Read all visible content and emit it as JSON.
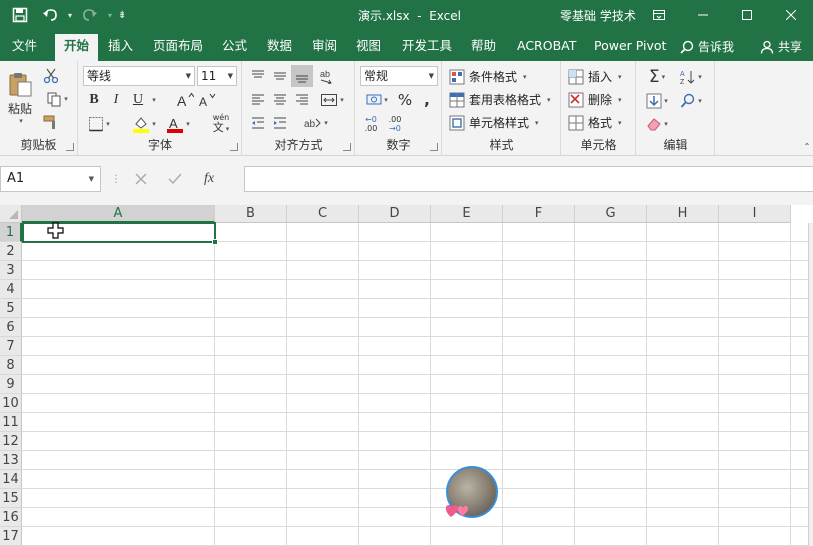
{
  "titlebar": {
    "doc_title": "演示.xlsx  -  Excel",
    "brand": "零基础 学技术"
  },
  "tabs": [
    {
      "label": "文件"
    },
    {
      "label": "开始"
    },
    {
      "label": "插入"
    },
    {
      "label": "页面布局"
    },
    {
      "label": "公式"
    },
    {
      "label": "数据"
    },
    {
      "label": "审阅"
    },
    {
      "label": "视图"
    },
    {
      "label": "开发工具"
    },
    {
      "label": "帮助"
    },
    {
      "label": "ACROBAT"
    },
    {
      "label": "Power Pivot"
    }
  ],
  "tellme": "告诉我",
  "share": "共享",
  "ribbon": {
    "clipboard": {
      "paste": "粘贴",
      "label": "剪贴板"
    },
    "font": {
      "name": "等线",
      "size": "11",
      "label": "字体",
      "bold": "B",
      "italic": "I",
      "underline": "U",
      "phonetic": "wén",
      "font_color": "#e00000",
      "highlight_color": "#ffff00"
    },
    "alignment": {
      "label": "对齐方式"
    },
    "number": {
      "format": "常规",
      "label": "数字",
      "percent": "%",
      "comma": ",",
      "inc_decimal": ".00",
      "dec_decimal": ".00"
    },
    "styles": {
      "conditional": "条件格式",
      "table": "套用表格格式",
      "cell": "单元格样式",
      "label": "样式"
    },
    "cells": {
      "insert": "插入",
      "delete": "删除",
      "format": "格式",
      "label": "单元格"
    },
    "editing": {
      "label": "编辑"
    }
  },
  "formula_bar": {
    "name_box": "A1",
    "fx": "fx",
    "content": ""
  },
  "grid": {
    "columns": [
      "A",
      "B",
      "C",
      "D",
      "E",
      "F",
      "G",
      "H",
      "I"
    ],
    "rows": [
      "1",
      "2",
      "3",
      "4",
      "5",
      "6",
      "7",
      "8",
      "9",
      "10",
      "11",
      "12",
      "13",
      "14",
      "15",
      "16",
      "17"
    ],
    "selected_cell": "A1"
  },
  "colors": {
    "accent": "#217346"
  }
}
